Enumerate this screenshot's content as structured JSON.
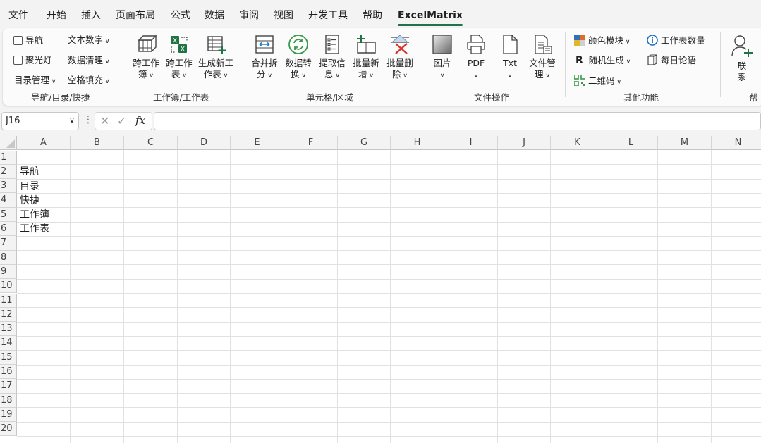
{
  "menu": [
    "文件",
    "开始",
    "插入",
    "页面布局",
    "公式",
    "数据",
    "审阅",
    "视图",
    "开发工具",
    "帮助",
    "ExcelMatrix"
  ],
  "ribbon": {
    "nav_group": {
      "nav_check": "导航",
      "spotlight_check": "聚光灯",
      "dir_manage": "目录管理",
      "text_number": "文本数字",
      "data_clean": "数据清理",
      "blank_fill": "空格填充",
      "label": "导航/目录/快捷"
    },
    "workbook_group": {
      "cross_wb_1": "跨工作",
      "cross_wb_2": "簿",
      "cross_ws_1": "跨工作",
      "cross_ws_2": "表",
      "gen_ws_1": "生成新工",
      "gen_ws_2": "作表",
      "label": "工作簿/工作表"
    },
    "cell_group": {
      "merge_1": "合并拆",
      "merge_2": "分",
      "convert_1": "数据转",
      "convert_2": "换",
      "extract_1": "提取信",
      "extract_2": "息",
      "batch_add_1": "批量新",
      "batch_add_2": "增",
      "batch_del_1": "批量删",
      "batch_del_2": "除",
      "label": "单元格/区域"
    },
    "file_group": {
      "image": "图片",
      "pdf": "PDF",
      "txt": "Txt",
      "file_mgr_1": "文件管",
      "file_mgr_2": "理",
      "label": "文件操作"
    },
    "other_group": {
      "color_module": "颜色模块",
      "random_gen": "随机生成",
      "qr_code": "二维码",
      "ws_count": "工作表数量",
      "daily_quote": "每日论语",
      "label": "其他功能"
    },
    "help_group": {
      "contact_1": "联",
      "contact_2": "系",
      "label": "帮"
    }
  },
  "formula_bar": {
    "name_box": "J16",
    "fx_symbol": "fx",
    "formula": ""
  },
  "columns": [
    "A",
    "B",
    "C",
    "D",
    "E",
    "F",
    "G",
    "H",
    "I",
    "J",
    "K",
    "L",
    "M",
    "N"
  ],
  "rows": [
    "1",
    "2",
    "3",
    "4",
    "5",
    "6",
    "7",
    "8",
    "9",
    "10",
    "11",
    "12",
    "13",
    "14",
    "15",
    "16",
    "17",
    "18",
    "19",
    "20"
  ],
  "cells": {
    "A2": "导航",
    "A3": "目录",
    "A4": "快捷",
    "A5": "工作簿",
    "A6": "工作表"
  },
  "colors": {
    "accent": "#217346",
    "ribbon_bg": "#fbfbfb",
    "grid_line": "#e1e1e1"
  }
}
